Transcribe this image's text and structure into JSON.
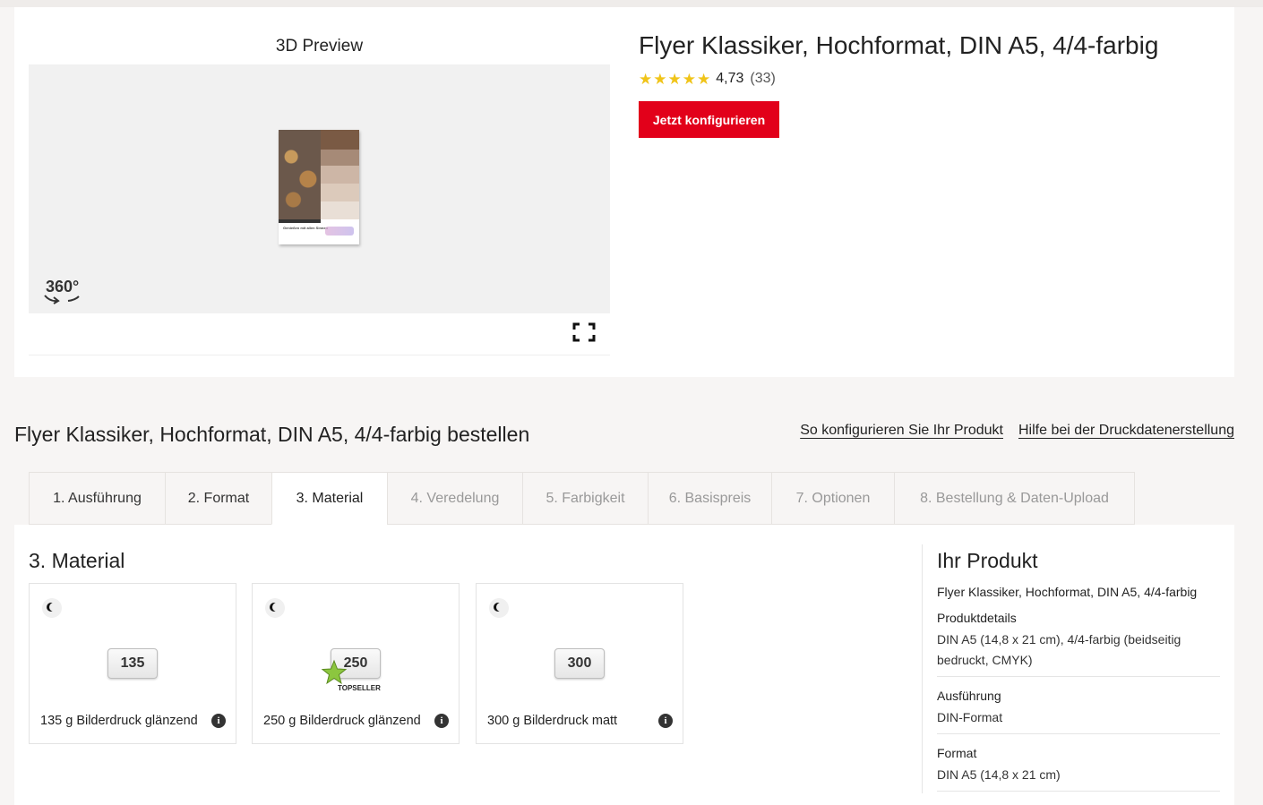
{
  "preview": {
    "title": "3D Preview",
    "flyer_text": "Genießen mit allen Sinnen",
    "rotate_label": "360°"
  },
  "product": {
    "title": "Flyer Klassiker, Hochformat, DIN A5, 4/4-farbig",
    "rating_value": 4.73,
    "rating_score": "4,73",
    "rating_count": "(33)",
    "configure_button": "Jetzt konfigurieren"
  },
  "order": {
    "title": "Flyer Klassiker, Hochformat, DIN A5, 4/4-farbig bestellen",
    "help_links": [
      "So konfigurieren Sie Ihr Produkt",
      "Hilfe bei der Druckdatenerstellung"
    ]
  },
  "tabs": [
    {
      "label": "1. Ausführung",
      "state": "done"
    },
    {
      "label": "2. Format",
      "state": "done"
    },
    {
      "label": "3. Material",
      "state": "active"
    },
    {
      "label": "4. Veredelung",
      "state": "disabled"
    },
    {
      "label": "5. Farbigkeit",
      "state": "disabled"
    },
    {
      "label": "6. Basispreis",
      "state": "disabled"
    },
    {
      "label": "7. Optionen",
      "state": "disabled"
    },
    {
      "label": "8. Bestellung & Daten-Upload",
      "state": "disabled"
    }
  ],
  "material": {
    "heading": "3. Material",
    "options": [
      {
        "badge": "135",
        "label": "135 g Bilderdruck glänzend",
        "topseller": false
      },
      {
        "badge": "250",
        "label": "250 g Bilderdruck glänzend",
        "topseller": true
      },
      {
        "badge": "300",
        "label": "300 g Bilderdruck matt",
        "topseller": false
      }
    ],
    "topseller_label": "TOPSELLER"
  },
  "summary": {
    "heading": "Ihr Produkt",
    "product_name": "Flyer Klassiker, Hochformat, DIN A5, 4/4-farbig",
    "details": [
      {
        "key": "Produktdetails",
        "value": "DIN A5 (14,8 x 21 cm), 4/4-farbig (beidseitig bedruckt, CMYK)"
      },
      {
        "key": "Ausführung",
        "value": "DIN-Format"
      },
      {
        "key": "Format",
        "value": "DIN A5 (14,8 x 21 cm)"
      }
    ]
  },
  "colors": {
    "accent": "#e2001a",
    "star": "#f0c419",
    "background": "#f7f5f4"
  }
}
